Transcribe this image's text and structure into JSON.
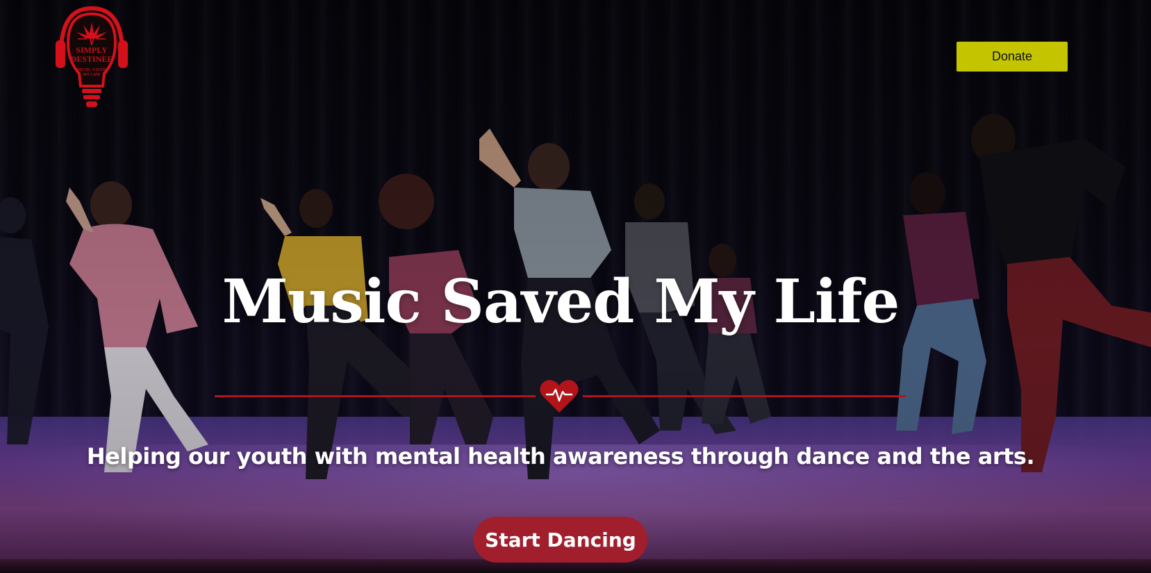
{
  "logo": {
    "name_line1": "SIMPLY",
    "name_line2": "DESTINEE",
    "tagline_line1": "MUSIC SAVED",
    "tagline_line2": "MY LIFE",
    "icon": "headphones-lightbulb-logo",
    "color": "#d4111b"
  },
  "header": {
    "donate_label": "Donate",
    "donate_color": "#c4c400"
  },
  "hero": {
    "title": "Music Saved My Life",
    "divider_icon": "heart-pulse-icon",
    "divider_color": "#b3141a",
    "subtitle": "Helping our youth with mental health awareness through dance and the arts.",
    "cta_label": "Start Dancing",
    "cta_color": "#a11f2c",
    "background": "stage-dancers-photo"
  }
}
